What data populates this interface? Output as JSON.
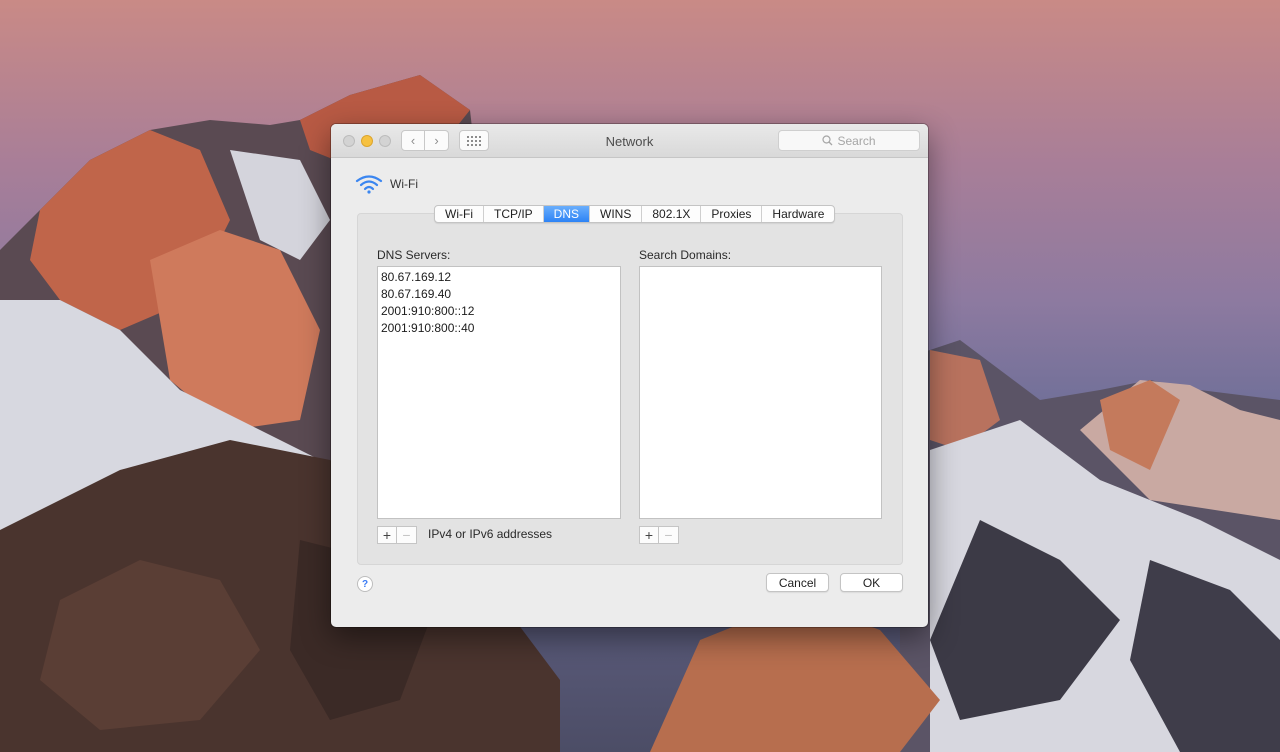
{
  "window": {
    "title": "Network",
    "search_placeholder": "Search"
  },
  "interface": {
    "name": "Wi-Fi",
    "icon": "wifi-icon"
  },
  "tabs": [
    {
      "label": "Wi-Fi",
      "active": false
    },
    {
      "label": "TCP/IP",
      "active": false
    },
    {
      "label": "DNS",
      "active": true
    },
    {
      "label": "WINS",
      "active": false
    },
    {
      "label": "802.1X",
      "active": false
    },
    {
      "label": "Proxies",
      "active": false
    },
    {
      "label": "Hardware",
      "active": false
    }
  ],
  "dns": {
    "servers_label": "DNS Servers:",
    "servers": [
      "80.67.169.12",
      "80.67.169.40",
      "2001:910:800::12",
      "2001:910:800::40"
    ],
    "hint": "IPv4 or IPv6 addresses"
  },
  "search_domains": {
    "label": "Search Domains:",
    "domains": []
  },
  "controls": {
    "add": "+",
    "remove": "−",
    "help": "?",
    "cancel": "Cancel",
    "ok": "OK"
  },
  "colors": {
    "accent": "#2d83f5",
    "minimize": "#f6c140"
  }
}
